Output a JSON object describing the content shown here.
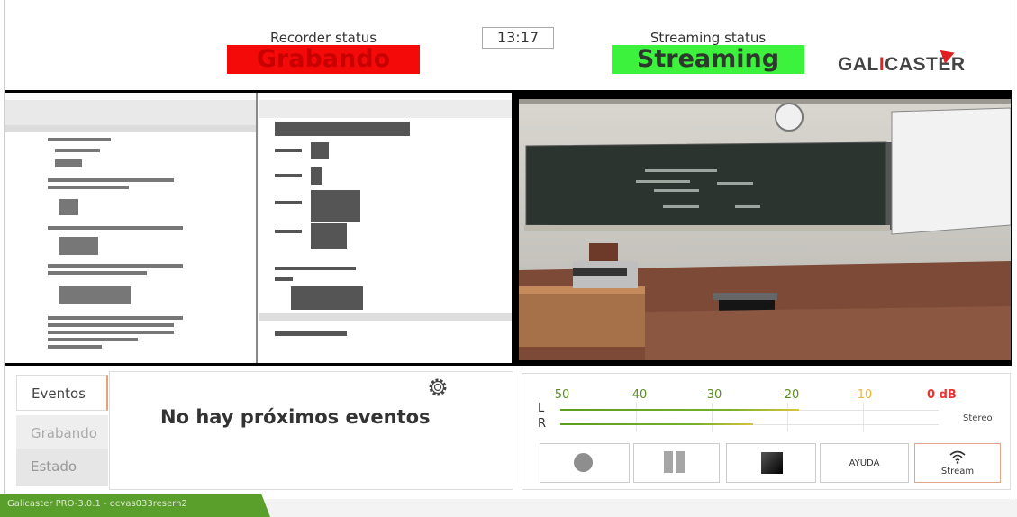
{
  "header": {
    "recorder_status_label": "Recorder status",
    "recorder_status_value": "Grabando",
    "clock": "13:17",
    "streaming_status_label": "Streaming status",
    "streaming_status_value": "Streaming",
    "logo_text": "GALICASTER",
    "colors": {
      "recording": "#f50a0a",
      "streaming": "#3cf23c"
    }
  },
  "previews": {
    "screen_math": [
      "ƒ(θ)= ∫ f(x) e^{-ikx} dx",
      "Es ergibt sich:",
      "p = h/λ",
      "De Broglie-Gleichung",
      "λ = h / p",
      "√(1 - v²/c²)"
    ]
  },
  "tabs": [
    "Eventos",
    "Grabando",
    "Estado"
  ],
  "events": {
    "empty_message": "No hay próximos eventos"
  },
  "audio": {
    "db_labels": [
      "-50",
      "-40",
      "-30",
      "-20",
      "-10",
      "0 dB"
    ],
    "left_label": "L",
    "right_label": "R",
    "mode": "Stereo",
    "level_left": 0.63,
    "level_right": 0.51
  },
  "controls": {
    "help": "AYUDA",
    "stream": "Stream"
  },
  "footer": {
    "text": "Galicaster PRO-3.0.1 - ocvas033resern2"
  }
}
